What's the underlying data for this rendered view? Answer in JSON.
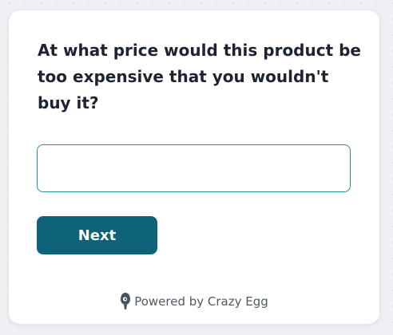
{
  "survey": {
    "question": "At what price would this product be too expensive that you wouldn't buy it?",
    "answer_value": "",
    "next_label": "Next"
  },
  "footer": {
    "powered_by_text": "Powered by Crazy Egg",
    "icon": "crazy-egg-logo-icon"
  },
  "colors": {
    "button": "#0f6379",
    "input_border": "#2a8f9b",
    "question_text": "#1b2430",
    "footer_text": "#505a66",
    "page_background": "#eef0f4",
    "card_background": "#ffffff"
  }
}
